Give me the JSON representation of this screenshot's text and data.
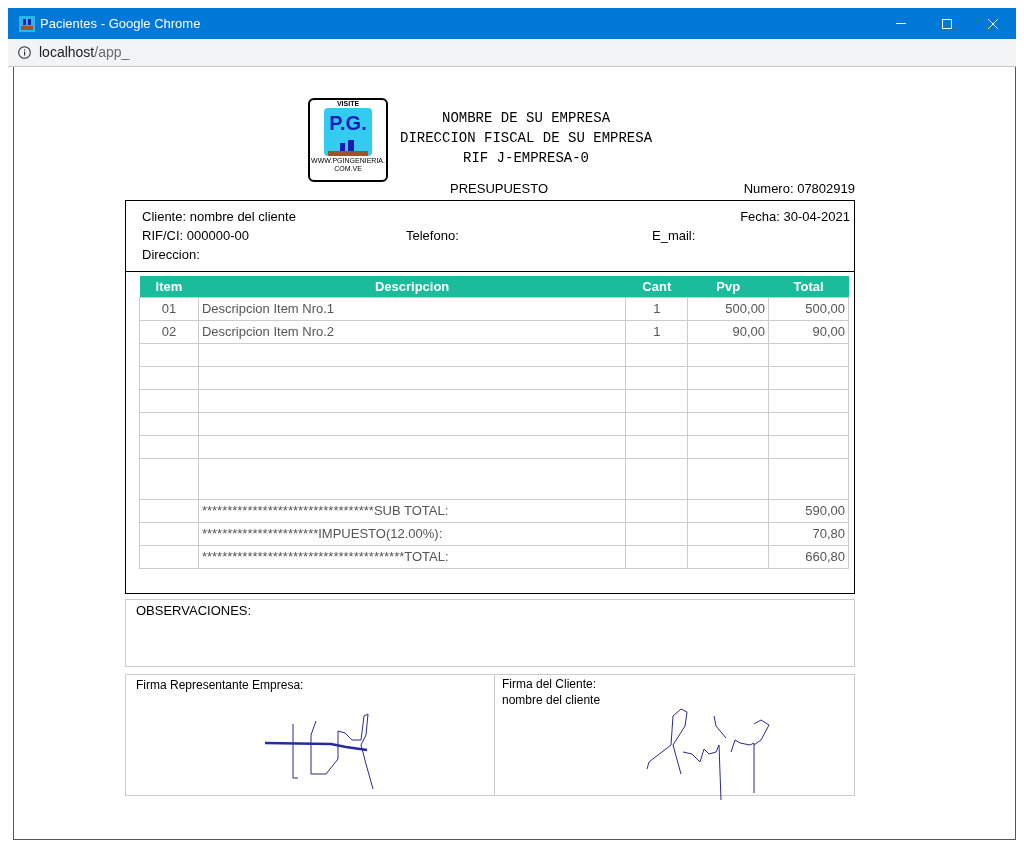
{
  "window": {
    "title": "Pacientes - Google Chrome",
    "address_host": "localhost",
    "address_path": "/app_"
  },
  "header": {
    "lines": [
      "NOMBRE DE SU EMPRESA",
      "DIRECCION FISCAL DE SU EMPRESA",
      "RIF J-EMPRESA-0"
    ],
    "logo_top": "VISITE",
    "logo_mark": "P.G.",
    "logo_bottom": "WWW.PGINGENIERIA.COM.VE"
  },
  "document": {
    "title": "PRESUPUESTO",
    "numero": "Numero: 07802919"
  },
  "client": {
    "cliente": "Cliente: nombre del cliente",
    "fecha": "Fecha: 30-04-2021",
    "rif": "RIF/CI: 000000-00",
    "telefono": "Telefono:",
    "email": "E_mail:",
    "direccion": "Direccion:"
  },
  "table": {
    "columns": [
      "Item",
      "Descripcion",
      "Cant",
      "Pvp",
      "Total"
    ],
    "rows": [
      {
        "item": "01",
        "descripcion": "Descripcion Item Nro.1",
        "cant": "1",
        "pvp": "500,00",
        "total": "500,00"
      },
      {
        "item": "02",
        "descripcion": "Descripcion Item Nro.2",
        "cant": "1",
        "pvp": "90,00",
        "total": "90,00"
      }
    ],
    "totals": [
      {
        "label": "**********************************SUB TOTAL:",
        "value": "590,00"
      },
      {
        "label": "***********************IMPUESTO(12.00%):",
        "value": "70,80"
      },
      {
        "label": "****************************************TOTAL:",
        "value": "660,80"
      }
    ]
  },
  "observaciones": {
    "label": "OBSERVACIONES:"
  },
  "signatures": [
    {
      "label": "Firma Representante Empresa:"
    },
    {
      "label": "Firma del Cliente:",
      "name": "nombre del cliente"
    }
  ]
}
